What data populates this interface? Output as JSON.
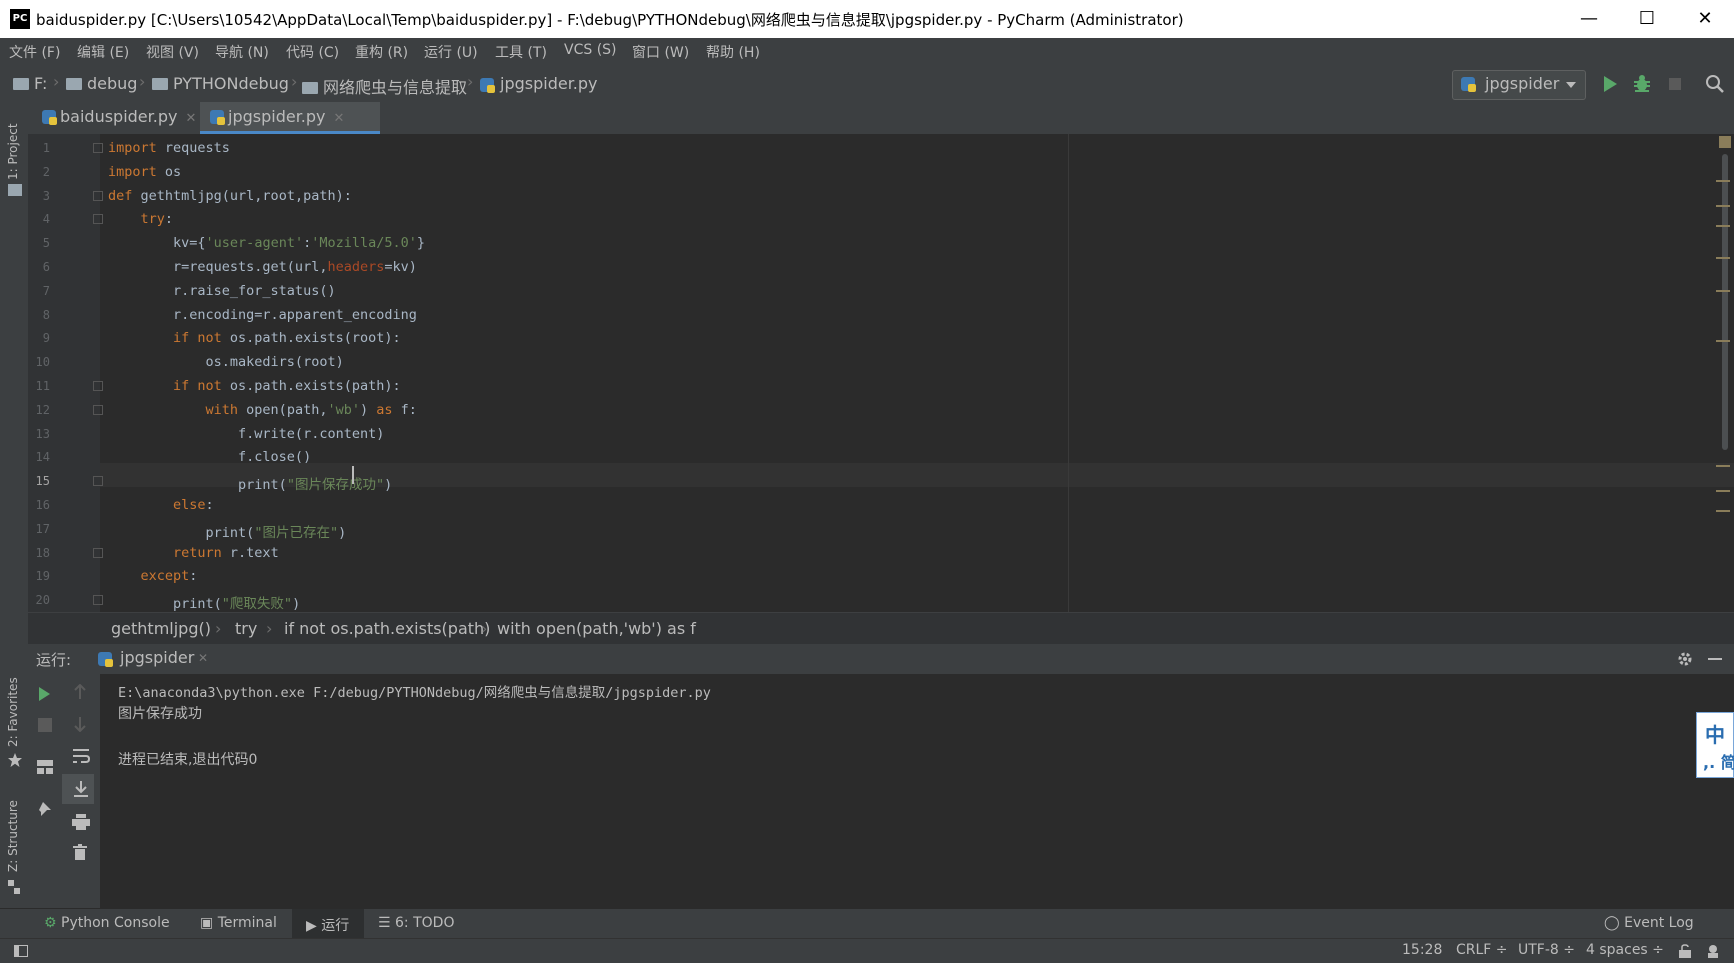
{
  "window": {
    "app_icon": "PC",
    "title": "baiduspider.py [C:\\Users\\10542\\AppData\\Local\\Temp\\baiduspider.py] - F:\\debug\\PYTHONdebug\\网络爬虫与信息提取\\jpgspider.py - PyCharm (Administrator)",
    "minimize": "—",
    "maximize": "☐",
    "close": "✕"
  },
  "menu": [
    "文件 (F)",
    "编辑 (E)",
    "视图 (V)",
    "导航 (N)",
    "代码 (C)",
    "重构 (R)",
    "运行 (U)",
    "工具 (T)",
    "VCS (S)",
    "窗口 (W)",
    "帮助 (H)"
  ],
  "nav": {
    "crumbs": [
      "F:",
      "debug",
      "PYTHONdebug",
      "网络爬虫与信息提取",
      "jpgspider.py"
    ],
    "run_config": "jpgspider"
  },
  "sidebar_left": {
    "project": "1: Project",
    "favorites": "2: Favorites",
    "structure": "Z: Structure"
  },
  "tabs": [
    {
      "label": "baiduspider.py",
      "active": false
    },
    {
      "label": "jpgspider.py",
      "active": true
    }
  ],
  "editor": {
    "line_numbers": [
      "1",
      "2",
      "3",
      "4",
      "5",
      "6",
      "7",
      "8",
      "9",
      "10",
      "11",
      "12",
      "13",
      "14",
      "15",
      "16",
      "17",
      "18",
      "19",
      "20"
    ],
    "current_line": "15",
    "lines": [
      [
        {
          "t": "import",
          "c": "kw"
        },
        {
          "t": " requests",
          "c": ""
        }
      ],
      [
        {
          "t": "import",
          "c": "kw"
        },
        {
          "t": " os",
          "c": ""
        }
      ],
      [
        {
          "t": "def",
          "c": "kw"
        },
        {
          "t": " gethtmljpg(url,root,path):",
          "c": ""
        }
      ],
      [
        {
          "t": "    try",
          "c": "kw"
        },
        {
          "t": ":",
          "c": ""
        }
      ],
      [
        {
          "t": "        kv={",
          "c": ""
        },
        {
          "t": "'user-agent'",
          "c": "str"
        },
        {
          "t": ":",
          "c": ""
        },
        {
          "t": "'Mozilla/5.0'",
          "c": "str"
        },
        {
          "t": "}",
          "c": ""
        }
      ],
      [
        {
          "t": "        r=requests.get(url,",
          "c": ""
        },
        {
          "t": "headers",
          "c": "prm"
        },
        {
          "t": "=kv)",
          "c": ""
        }
      ],
      [
        {
          "t": "        r.raise_for_status()",
          "c": ""
        }
      ],
      [
        {
          "t": "        r.encoding=r.apparent_encoding",
          "c": ""
        }
      ],
      [
        {
          "t": "        if not",
          "c": "kw"
        },
        {
          "t": " os.path.exists(root):",
          "c": ""
        }
      ],
      [
        {
          "t": "            os.makedirs(root)",
          "c": ""
        }
      ],
      [
        {
          "t": "        if not",
          "c": "kw"
        },
        {
          "t": " os.path.exists(path):",
          "c": ""
        }
      ],
      [
        {
          "t": "            with",
          "c": "kw"
        },
        {
          "t": " open(path,",
          "c": ""
        },
        {
          "t": "'wb'",
          "c": "str"
        },
        {
          "t": ") ",
          "c": ""
        },
        {
          "t": "as",
          "c": "kw"
        },
        {
          "t": " f:",
          "c": ""
        }
      ],
      [
        {
          "t": "                f.write(r.content)",
          "c": ""
        }
      ],
      [
        {
          "t": "                f.close()",
          "c": ""
        }
      ],
      [
        {
          "t": "                print(",
          "c": ""
        },
        {
          "t": "\"图片保存成功\"",
          "c": "str"
        },
        {
          "t": ")",
          "c": ""
        }
      ],
      [
        {
          "t": "        else",
          "c": "kw"
        },
        {
          "t": ":",
          "c": ""
        }
      ],
      [
        {
          "t": "            print(",
          "c": ""
        },
        {
          "t": "\"图片已存在\"",
          "c": "str"
        },
        {
          "t": ")",
          "c": ""
        }
      ],
      [
        {
          "t": "        return",
          "c": "kw"
        },
        {
          "t": " r.text",
          "c": ""
        }
      ],
      [
        {
          "t": "    except",
          "c": "kw"
        },
        {
          "t": ":",
          "c": ""
        }
      ],
      [
        {
          "t": "        print(",
          "c": ""
        },
        {
          "t": "\"爬取失败\"",
          "c": "str"
        },
        {
          "t": ")",
          "c": ""
        }
      ]
    ],
    "breadcrumbs": [
      "gethtmljpg()",
      "try",
      "if not os.path.exists(path)",
      "with open(path,'wb') as f"
    ]
  },
  "run": {
    "label": "运行:",
    "tab": "jpgspider",
    "output": [
      "E:\\anaconda3\\python.exe F:/debug/PYTHONdebug/网络爬虫与信息提取/jpgspider.py",
      "图片保存成功",
      "",
      "进程已结束,退出代码0"
    ]
  },
  "bottom_tools": {
    "python_console": "Python Console",
    "terminal": "Terminal",
    "run": "运行",
    "todo": "6: TODO",
    "event_log": "Event Log"
  },
  "status": {
    "position": "15:28",
    "line_sep": "CRLF ÷",
    "encoding": "UTF-8 ÷",
    "indent": "4 spaces ÷"
  },
  "ime": {
    "line1": "中",
    "line2": ",. 简"
  },
  "colors": {
    "keyword": "#cc7832",
    "string": "#6a8759",
    "param": "#aa4926",
    "accent": "#4a88c7",
    "run_green": "#59a869"
  }
}
